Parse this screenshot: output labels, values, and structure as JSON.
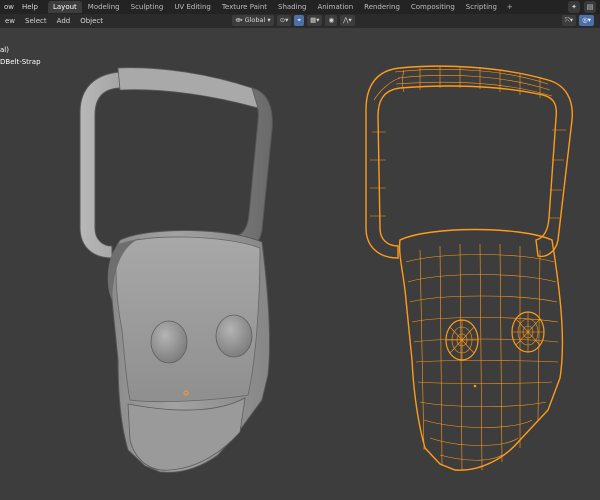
{
  "topbar": {
    "menus": [
      "ow",
      "Help"
    ],
    "tabs": [
      "Layout",
      "Modeling",
      "Sculpting",
      "UV Editing",
      "Texture Paint",
      "Shading",
      "Animation",
      "Rendering",
      "Compositing",
      "Scripting"
    ],
    "active_tab": "Layout",
    "add_tab": "+"
  },
  "header": {
    "menus": [
      "ew",
      "Select",
      "Add",
      "Object"
    ],
    "orientation": "Global"
  },
  "overlay_text": {
    "line1": "al)",
    "line2": "DBelt-Strap"
  },
  "colors": {
    "wire": "#ff9b1a",
    "solid": "#9e9e9e",
    "background": "#3d3d3d"
  }
}
